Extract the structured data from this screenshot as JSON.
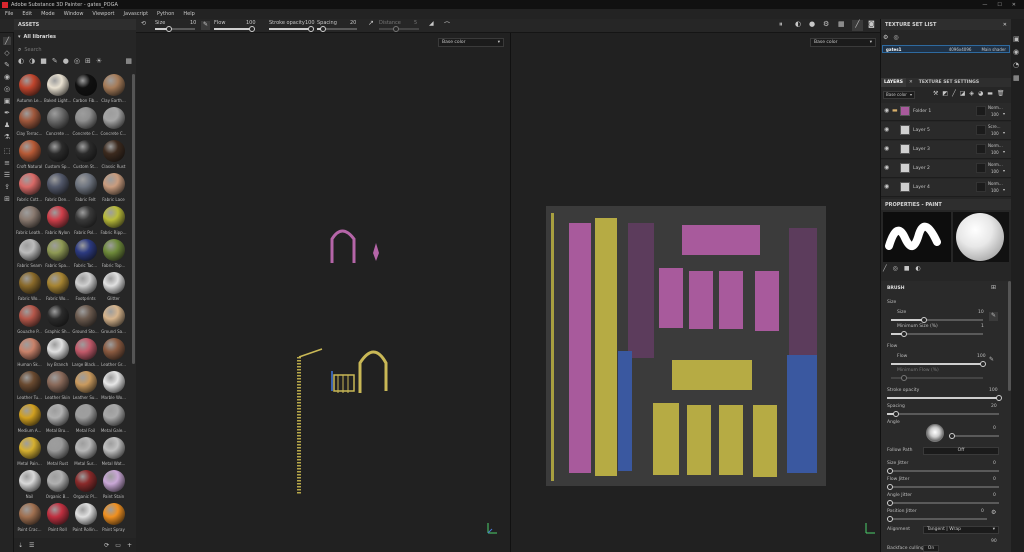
{
  "app": {
    "title": "Adobe Substance 3D Painter - gates_POGA"
  },
  "menu": [
    "File",
    "Edit",
    "Mode",
    "Window",
    "Viewport",
    "Javascript",
    "Python",
    "Help"
  ],
  "toolbar": {
    "size_label": "Size",
    "size_value": "10",
    "flow_label": "Flow",
    "flow_value": "100",
    "stroke_opacity_label": "Stroke opacity",
    "stroke_opacity_value": "100",
    "spacing_label": "Spacing",
    "spacing_value": "20",
    "distance_label": "Distance",
    "distance_value": "5"
  },
  "assets": {
    "title": "ASSETS",
    "library": "All libraries",
    "search_placeholder": "Search",
    "items": [
      {
        "label": "Autumn Le...",
        "color": "#c0452d"
      },
      {
        "label": "Baked Light...",
        "color": "#e8e0d0"
      },
      {
        "label": "Carbon Fib...",
        "color": "#101010"
      },
      {
        "label": "Clay Earth...",
        "color": "#a67c59"
      },
      {
        "label": "Clay Terrac...",
        "color": "#a0583c"
      },
      {
        "label": "Concrete ...",
        "color": "#6c6c6c"
      },
      {
        "label": "Concrete C...",
        "color": "#8f8f8f"
      },
      {
        "label": "Concrete C...",
        "color": "#a5a5a5"
      },
      {
        "label": "Croft Natural",
        "color": "#b75a36"
      },
      {
        "label": "Custom Sp...",
        "color": "#2b2b2b"
      },
      {
        "label": "Custom St...",
        "color": "#2b2b2b"
      },
      {
        "label": "Classic Rust",
        "color": "#3c2a1e"
      },
      {
        "label": "Fabric Cott...",
        "color": "#d96a67"
      },
      {
        "label": "Fabric Den...",
        "color": "#52586a"
      },
      {
        "label": "Fabric Felt",
        "color": "#6f7580"
      },
      {
        "label": "Fabric Lace",
        "color": "#c99c7e"
      },
      {
        "label": "Fabric Leath...",
        "color": "#8a7a70"
      },
      {
        "label": "Fabric Nylon",
        "color": "#cf3f4a"
      },
      {
        "label": "Fabric Pol...",
        "color": "#3a3a3a"
      },
      {
        "label": "Fabric Ripp...",
        "color": "#b9bb3a"
      },
      {
        "label": "Fabric Seam",
        "color": "#bbbbbb"
      },
      {
        "label": "Fabric Spa...",
        "color": "#8f9a55"
      },
      {
        "label": "Fabric Tac...",
        "color": "#2c3a80"
      },
      {
        "label": "Fabric Top...",
        "color": "#6e8a3a"
      },
      {
        "label": "Fabric Wo...",
        "color": "#8a6a2a"
      },
      {
        "label": "Fabric Wo...",
        "color": "#a68432"
      },
      {
        "label": "Footprints",
        "color": "#d0d0d0"
      },
      {
        "label": "Glitter",
        "color": "#e0e0e0"
      },
      {
        "label": "Gouache P...",
        "color": "#b5574a"
      },
      {
        "label": "Graphic Sh...",
        "color": "#2b2b2b"
      },
      {
        "label": "Ground Sto...",
        "color": "#6b5a4e"
      },
      {
        "label": "Ground Sa...",
        "color": "#d6b48c"
      },
      {
        "label": "Human Sk...",
        "color": "#c9826a"
      },
      {
        "label": "Ivy Branch",
        "color": "#e0e0e0"
      },
      {
        "label": "Large Black...",
        "color": "#c25a6a"
      },
      {
        "label": "Leather Gr...",
        "color": "#8a5a40"
      },
      {
        "label": "Leather Tu...",
        "color": "#6a4a30"
      },
      {
        "label": "Leather Skin",
        "color": "#8a6a5a"
      },
      {
        "label": "Leather Su...",
        "color": "#c99a5e"
      },
      {
        "label": "Marble Wo...",
        "color": "#e6e6e6"
      },
      {
        "label": "Medium A...",
        "color": "#d1a020"
      },
      {
        "label": "Metal Bru...",
        "color": "#b0b0b0"
      },
      {
        "label": "Metal Foil",
        "color": "#9e9e9e"
      },
      {
        "label": "Metal Gale...",
        "color": "#a8a8a8"
      },
      {
        "label": "Metal Pain...",
        "color": "#d6b030"
      },
      {
        "label": "Metal Rust",
        "color": "#9a9a9a"
      },
      {
        "label": "Metal Sur...",
        "color": "#b7b7b7"
      },
      {
        "label": "Metal Wat...",
        "color": "#c0c0c0"
      },
      {
        "label": "Nail",
        "color": "#d8d8d8"
      },
      {
        "label": "Organic B...",
        "color": "#b0b0b0"
      },
      {
        "label": "Organic Pl...",
        "color": "#8a2a2a"
      },
      {
        "label": "Paint Stain",
        "color": "#c9a7d6"
      },
      {
        "label": "Paint Crac...",
        "color": "#a07050"
      },
      {
        "label": "Paint Roll",
        "color": "#c03040"
      },
      {
        "label": "Paint Rollin...",
        "color": "#e0e0e0"
      },
      {
        "label": "Paint Spray",
        "color": "#f09020"
      }
    ]
  },
  "viewport": {
    "left_channel": "Base color",
    "right_channel": "Base color"
  },
  "texture_set_list": {
    "title": "TEXTURE SET LIST",
    "item": {
      "name": "gates1",
      "resolution": "4096x4096",
      "shader": "Main shader"
    }
  },
  "layers": {
    "tab_layers": "LAYERS",
    "tab_settings": "TEXTURE SET SETTINGS",
    "channel": "Base color",
    "items": [
      {
        "name": "Folder 1",
        "blend": "Norm...",
        "opacity": "100"
      },
      {
        "name": "Layer 5",
        "blend": "Scre...",
        "opacity": "100"
      },
      {
        "name": "Layer 3",
        "blend": "Norm...",
        "opacity": "100"
      },
      {
        "name": "Layer 2",
        "blend": "Norm...",
        "opacity": "100"
      },
      {
        "name": "Layer 4",
        "blend": "Norm...",
        "opacity": "100"
      }
    ]
  },
  "properties": {
    "title": "PROPERTIES - PAINT",
    "brush_header": "BRUSH",
    "size_group": "Size",
    "size_label": "Size",
    "size_value": "10",
    "min_size_label": "Minimum Size (%)",
    "min_size_value": "1",
    "flow_group": "Flow",
    "flow_label": "Flow",
    "flow_value": "100",
    "min_flow_label": "Minimum Flow (%)",
    "stroke_opacity_label": "Stroke opacity",
    "stroke_opacity_value": "100",
    "spacing_label": "Spacing",
    "spacing_value": "20",
    "angle_label": "Angle",
    "angle_value": "0",
    "follow_path_label": "Follow Path",
    "follow_path_value": "Off",
    "size_jitter_label": "Size Jitter",
    "size_jitter_value": "0",
    "flow_jitter_label": "Flow Jitter",
    "flow_jitter_value": "0",
    "angle_jitter_label": "Angle Jitter",
    "angle_jitter_value": "0",
    "position_jitter_label": "Position Jitter",
    "position_jitter_value": "0",
    "alignment_label": "Alignment",
    "alignment_value": "Tangent | Wrap",
    "backface_label": "Backface culling",
    "backface_value": "On",
    "backface_number": "90"
  }
}
